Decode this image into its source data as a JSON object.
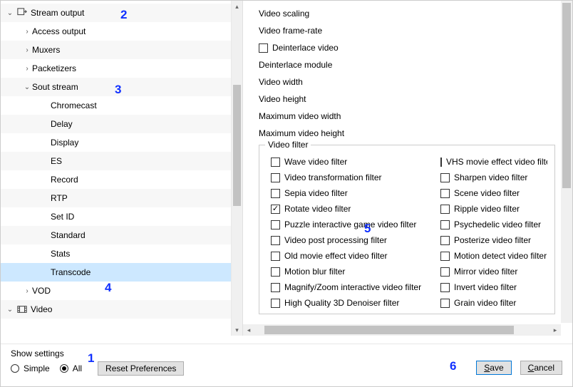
{
  "annotations": {
    "1": "1",
    "2": "2",
    "3": "3",
    "4": "4",
    "5": "5",
    "6": "6"
  },
  "tree": {
    "stream_output": "Stream output",
    "access_output": "Access output",
    "muxers": "Muxers",
    "packetizers": "Packetizers",
    "sout_stream": "Sout stream",
    "chromecast": "Chromecast",
    "delay": "Delay",
    "display": "Display",
    "es": "ES",
    "record": "Record",
    "rtp": "RTP",
    "set_id": "Set ID",
    "standard": "Standard",
    "stats": "Stats",
    "transcode": "Transcode",
    "vod": "VOD",
    "video": "Video"
  },
  "options": {
    "video_scaling": "Video scaling",
    "video_framerate": "Video frame-rate",
    "deinterlace_video": "Deinterlace video",
    "deinterlace_module": "Deinterlace module",
    "video_width": "Video width",
    "video_height": "Video height",
    "max_video_width": "Maximum video width",
    "max_video_height": "Maximum video height"
  },
  "filter_group_title": "Video filter",
  "filters_left": [
    {
      "label": "Wave video filter",
      "checked": false
    },
    {
      "label": "Video transformation filter",
      "checked": false
    },
    {
      "label": "Sepia video filter",
      "checked": false
    },
    {
      "label": "Rotate video filter",
      "checked": true
    },
    {
      "label": "Puzzle interactive game video filter",
      "checked": false
    },
    {
      "label": "Video post processing filter",
      "checked": false
    },
    {
      "label": "Old movie effect video filter",
      "checked": false
    },
    {
      "label": "Motion blur filter",
      "checked": false
    },
    {
      "label": "Magnify/Zoom interactive video filter",
      "checked": false
    },
    {
      "label": "High Quality 3D Denoiser filter",
      "checked": false
    }
  ],
  "filters_right": [
    {
      "label": "VHS movie effect video filter",
      "checked": false
    },
    {
      "label": "Sharpen video filter",
      "checked": false
    },
    {
      "label": "Scene video filter",
      "checked": false
    },
    {
      "label": "Ripple video filter",
      "checked": false
    },
    {
      "label": "Psychedelic video filter",
      "checked": false
    },
    {
      "label": "Posterize video filter",
      "checked": false
    },
    {
      "label": "Motion detect video filter",
      "checked": false
    },
    {
      "label": "Mirror video filter",
      "checked": false
    },
    {
      "label": "Invert video filter",
      "checked": false
    },
    {
      "label": "Grain video filter",
      "checked": false
    }
  ],
  "footer": {
    "show_settings": "Show settings",
    "simple": "Simple",
    "all": "All",
    "reset": "Reset Preferences",
    "save_u": "S",
    "save_rest": "ave",
    "cancel_u": "C",
    "cancel_rest": "ancel"
  }
}
